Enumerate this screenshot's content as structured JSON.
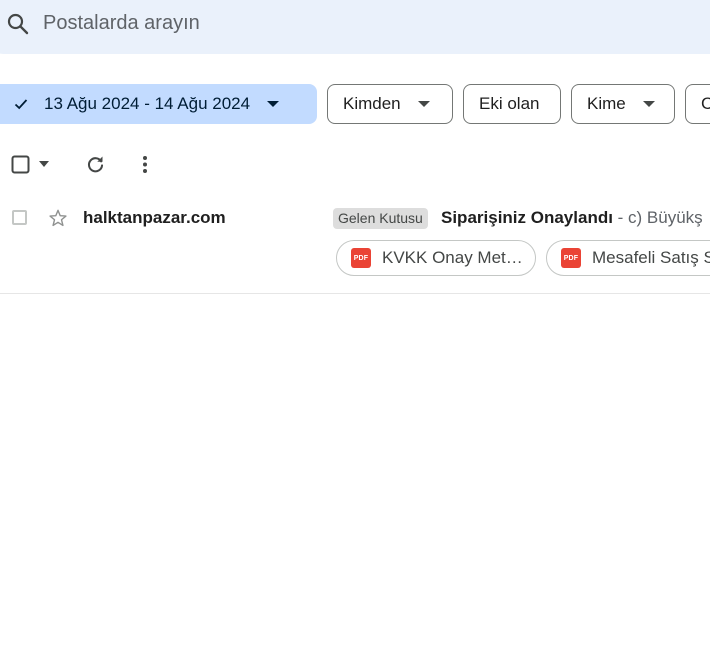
{
  "search": {
    "placeholder": "Postalarda arayın"
  },
  "filters": {
    "date_range": "13 Ağu 2024 - 14 Ağu 2024",
    "from": "Kimden",
    "has_attachment": "Eki olan",
    "to": "Kime",
    "more_partial": "C"
  },
  "email": {
    "sender": "halktanpazar.com",
    "label": "Gelen Kutusu",
    "subject": "Siparişiniz Onaylandı",
    "snippet": " - c) Büyükş",
    "attachments": [
      {
        "name": "KVKK Onay Met…",
        "icon": "pdf-icon"
      },
      {
        "name": "Mesafeli Satış S",
        "icon": "pdf-icon"
      }
    ],
    "pdf_badge": "PDF"
  },
  "colors": {
    "search_bg": "#eaf1fb",
    "active_chip_bg": "#c2dbff",
    "pdf_red": "#ea4335"
  }
}
